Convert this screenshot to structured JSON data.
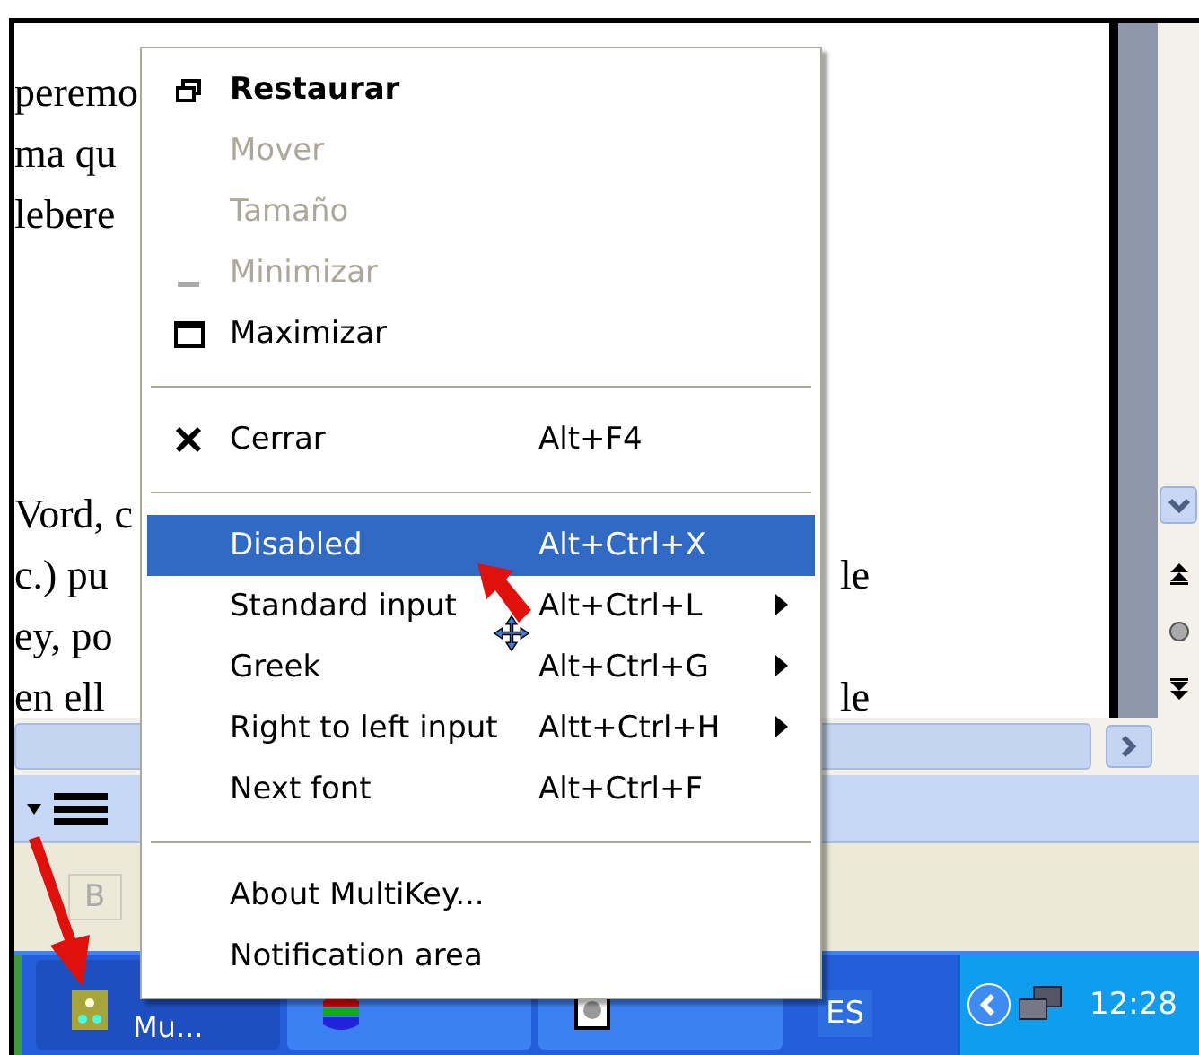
{
  "document": {
    "paragraphs": [
      {
        "lines": [
          {
            "left": "peremo"
          },
          {
            "left": "ma qu"
          },
          {
            "left": "lebere"
          }
        ]
      },
      {
        "lines": [
          {
            "left": "Vord, c"
          },
          {
            "left": "c.) pu",
            "right": "le"
          },
          {
            "left": "ey, po"
          },
          {
            "left": "en ell",
            "right": "le"
          }
        ]
      }
    ]
  },
  "status_bar": {
    "cells": [
      {
        "text": "B"
      }
    ]
  },
  "taskbar": {
    "buttons": [
      {
        "label": "Mu...",
        "selected": true
      },
      {
        "selected": false
      },
      {
        "selected": false
      }
    ],
    "language": "ES",
    "clock": "12:28"
  },
  "menu": {
    "items": [
      {
        "kind": "restore",
        "label": "Restaurar",
        "default": true,
        "disabled": false,
        "selected": false
      },
      {
        "kind": "plain",
        "label": "Mover",
        "disabled": true,
        "selected": false
      },
      {
        "kind": "plain",
        "label": "Tamaño",
        "disabled": true,
        "selected": false
      },
      {
        "kind": "minimize",
        "label": "Minimizar",
        "disabled": true,
        "selected": false
      },
      {
        "kind": "maximize",
        "label": "Maximizar",
        "disabled": false,
        "selected": false
      },
      {
        "kind": "separator"
      },
      {
        "kind": "close",
        "label": "Cerrar",
        "shortcut": "Alt+F4",
        "disabled": false,
        "selected": false
      },
      {
        "kind": "separator"
      },
      {
        "kind": "plain",
        "label": "Disabled",
        "shortcut": "Alt+Ctrl+X",
        "disabled": false,
        "selected": true
      },
      {
        "kind": "plain",
        "label": "Standard input",
        "shortcut": "Alt+Ctrl+L",
        "submenu": true,
        "disabled": false,
        "selected": false
      },
      {
        "kind": "plain",
        "label": "Greek",
        "shortcut": "Alt+Ctrl+G",
        "submenu": true,
        "disabled": false,
        "selected": false
      },
      {
        "kind": "plain",
        "label": "Right to left input",
        "shortcut": "Altt+Ctrl+H",
        "submenu": true,
        "disabled": false,
        "selected": false
      },
      {
        "kind": "plain",
        "label": "Next font",
        "shortcut": "Alt+Ctrl+F",
        "disabled": false,
        "selected": false
      },
      {
        "kind": "separator"
      },
      {
        "kind": "plain",
        "label": "About MultiKey...",
        "disabled": false,
        "selected": false
      },
      {
        "kind": "plain",
        "label": "Notification area",
        "disabled": false,
        "selected": false
      }
    ]
  }
}
